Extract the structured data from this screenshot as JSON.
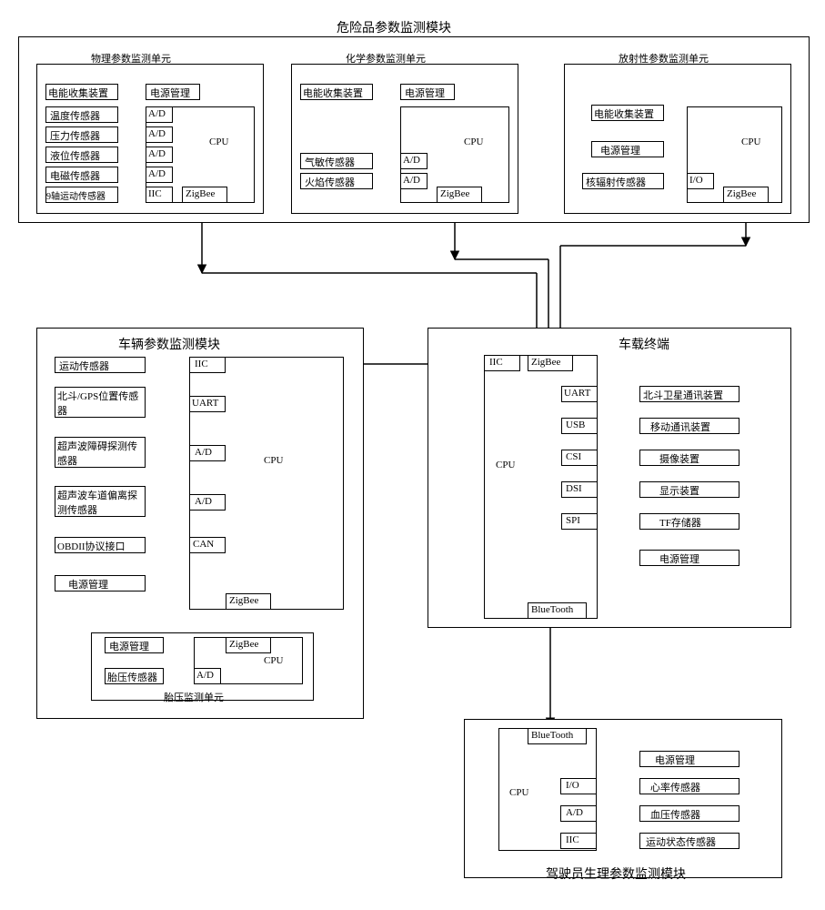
{
  "hazmat": {
    "title": "危险品参数监测模块",
    "physical": {
      "title": "物理参数监测单元",
      "energy": "电能收集装置",
      "power": "电源管理",
      "temp": "温度传感器",
      "pressure": "压力传感器",
      "level": "液位传感器",
      "em": "电磁传感器",
      "motion9": "9轴运动传感器",
      "ad": "A/D",
      "cpu": "CPU",
      "iic": "IIC",
      "zigbee": "ZigBee"
    },
    "chemical": {
      "title": "化学参数监测单元",
      "energy": "电能收集装置",
      "power": "电源管理",
      "gas": "气敏传感器",
      "flame": "火焰传感器",
      "ad": "A/D",
      "cpu": "CPU",
      "zigbee": "ZigBee"
    },
    "radiation": {
      "title": "放射性参数监测单元",
      "energy": "电能收集装置",
      "power": "电源管理",
      "nuclear": "核辐射传感器",
      "io": "I/O",
      "cpu": "CPU",
      "zigbee": "ZigBee"
    }
  },
  "vehicle": {
    "title": "车辆参数监测模块",
    "motion": "运动传感器",
    "gps": "北斗/GPS位置传感器",
    "ultra_obs": "超声波障碍探测传感器",
    "ultra_lane": "超声波车道偏离探测传感器",
    "obd": "OBDII协议接口",
    "power": "电源管理",
    "iic": "IIC",
    "uart": "UART",
    "ad": "A/D",
    "can": "CAN",
    "cpu": "CPU",
    "zigbee": "ZigBee",
    "tire": {
      "title": "胎压监测单元",
      "power": "电源管理",
      "tp": "胎压传感器",
      "zigbee": "ZigBee",
      "cpu": "CPU",
      "ad": "A/D"
    }
  },
  "terminal": {
    "title": "车载终端",
    "iic": "IIC",
    "zigbee": "ZigBee",
    "uart": "UART",
    "usb": "USB",
    "csi": "CSI",
    "dsi": "DSI",
    "spi": "SPI",
    "cpu": "CPU",
    "bluetooth": "BlueTooth",
    "beidou": "北斗卫星通讯装置",
    "mobile": "移动通讯装置",
    "camera": "摄像装置",
    "display": "显示装置",
    "tf": "TF存储器",
    "power": "电源管理"
  },
  "driver": {
    "title": "驾驶员生理参数监测模块",
    "bluetooth": "BlueTooth",
    "io": "I/O",
    "ad": "A/D",
    "iic": "IIC",
    "cpu": "CPU",
    "power": "电源管理",
    "heart": "心率传感器",
    "bp": "血压传感器",
    "motion": "运动状态传感器"
  }
}
